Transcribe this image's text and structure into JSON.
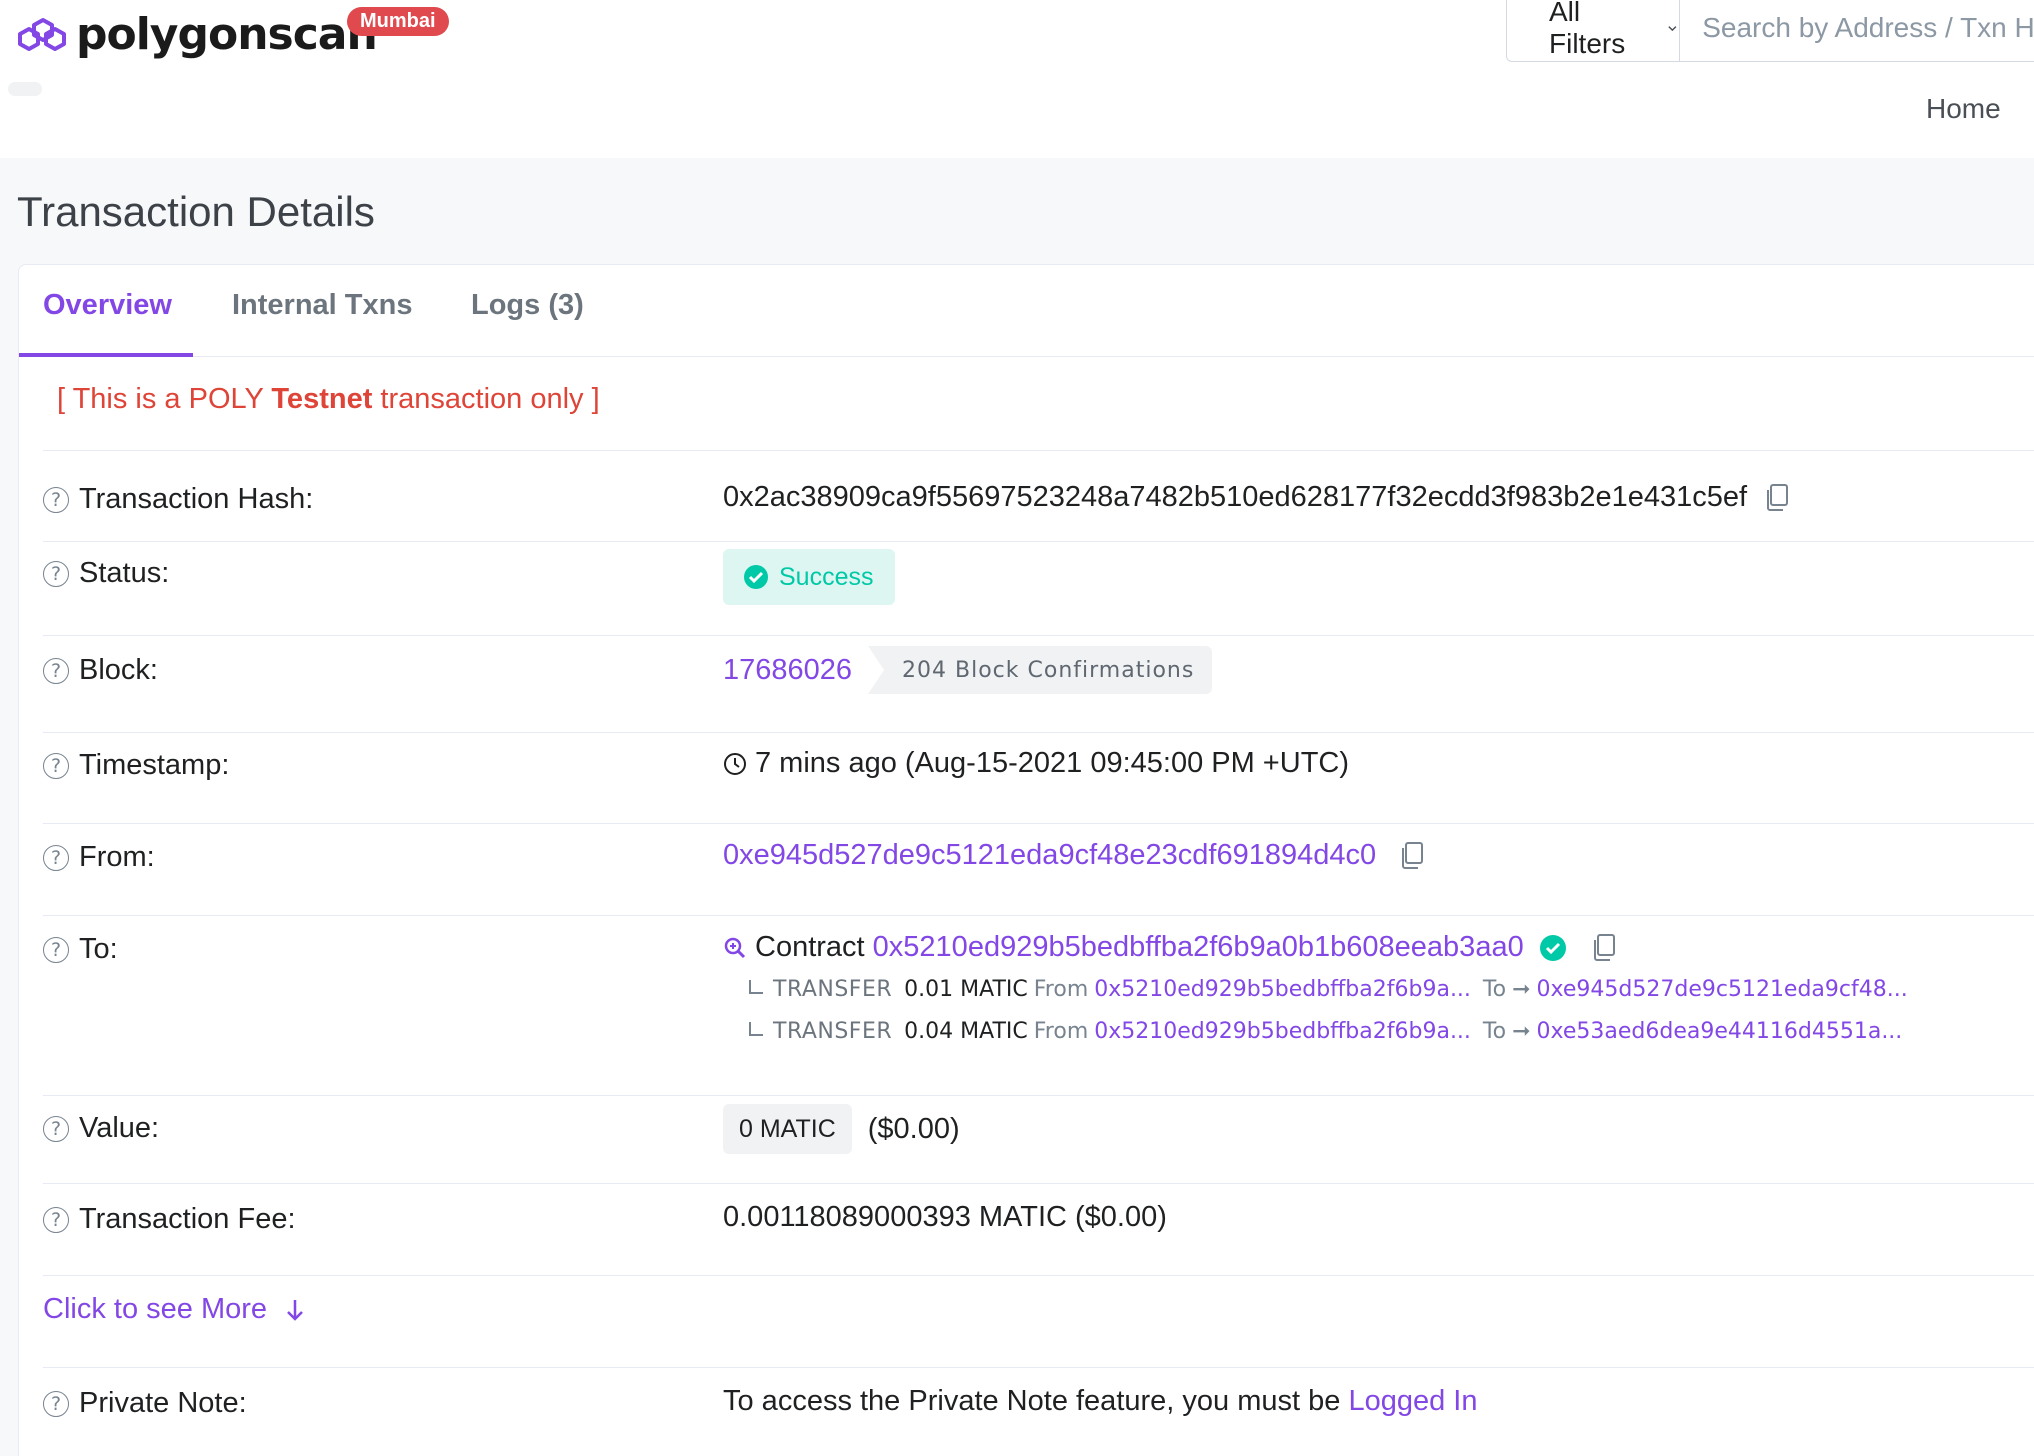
{
  "header": {
    "logo_text": "polygonscan",
    "network_badge": "Mumbai",
    "filter_label": "All Filters",
    "search_placeholder": "Search by Address / Txn Hash / Block / Token",
    "nav_home": "Home",
    "brand_color": "#8247e5",
    "badge_color": "#e0494e"
  },
  "page": {
    "title": "Transaction Details",
    "tabs": [
      {
        "label": "Overview",
        "active": true
      },
      {
        "label": "Internal Txns",
        "active": false
      },
      {
        "label": "Logs (3)",
        "active": false
      }
    ],
    "testnet_note": {
      "prefix": "[ This is a POLY ",
      "bold": "Testnet",
      "suffix": " transaction only ]"
    }
  },
  "details": {
    "help_icon_glyph": "?",
    "tx_hash": {
      "label": "Transaction Hash:",
      "value": "0x2ac38909ca9f55697523248a7482b510ed628177f32ecdd3f983b2e1e431c5ef"
    },
    "status": {
      "label": "Status:",
      "value": "Success",
      "color": "#00c9a7"
    },
    "block": {
      "label": "Block:",
      "value": "17686026",
      "confirmations": "204 Block Confirmations"
    },
    "timestamp": {
      "label": "Timestamp:",
      "value": "7 mins ago (Aug-15-2021 09:45:00 PM +UTC)"
    },
    "from": {
      "label": "From:",
      "value": "0xe945d527de9c5121eda9cf48e23cdf691894d4c0"
    },
    "to": {
      "label": "To:",
      "contract_word": "Contract",
      "value": "0x5210ed929b5bedbffba2f6b9a0b1b608eeab3aa0",
      "transfers": [
        {
          "type": "TRANSFER",
          "amount": "0.01 MATIC",
          "from_word": "From",
          "from": "0x5210ed929b5bedbffba2f6b9a...",
          "to_word": "To",
          "to": "0xe945d527de9c5121eda9cf48..."
        },
        {
          "type": "TRANSFER",
          "amount": "0.04 MATIC",
          "from_word": "From",
          "from": "0x5210ed929b5bedbffba2f6b9a...",
          "to_word": "To",
          "to": "0xe53aed6dea9e44116d4551a..."
        }
      ]
    },
    "value": {
      "label": "Value:",
      "amount": "0 MATIC",
      "usd": "($0.00)"
    },
    "fee": {
      "label": "Transaction Fee:",
      "value": "0.00118089000393 MATIC ($0.00)"
    },
    "see_more": "Click to see More",
    "private_note": {
      "label": "Private Note:",
      "text": "To access the Private Note feature, you must be ",
      "link": "Logged In"
    }
  }
}
